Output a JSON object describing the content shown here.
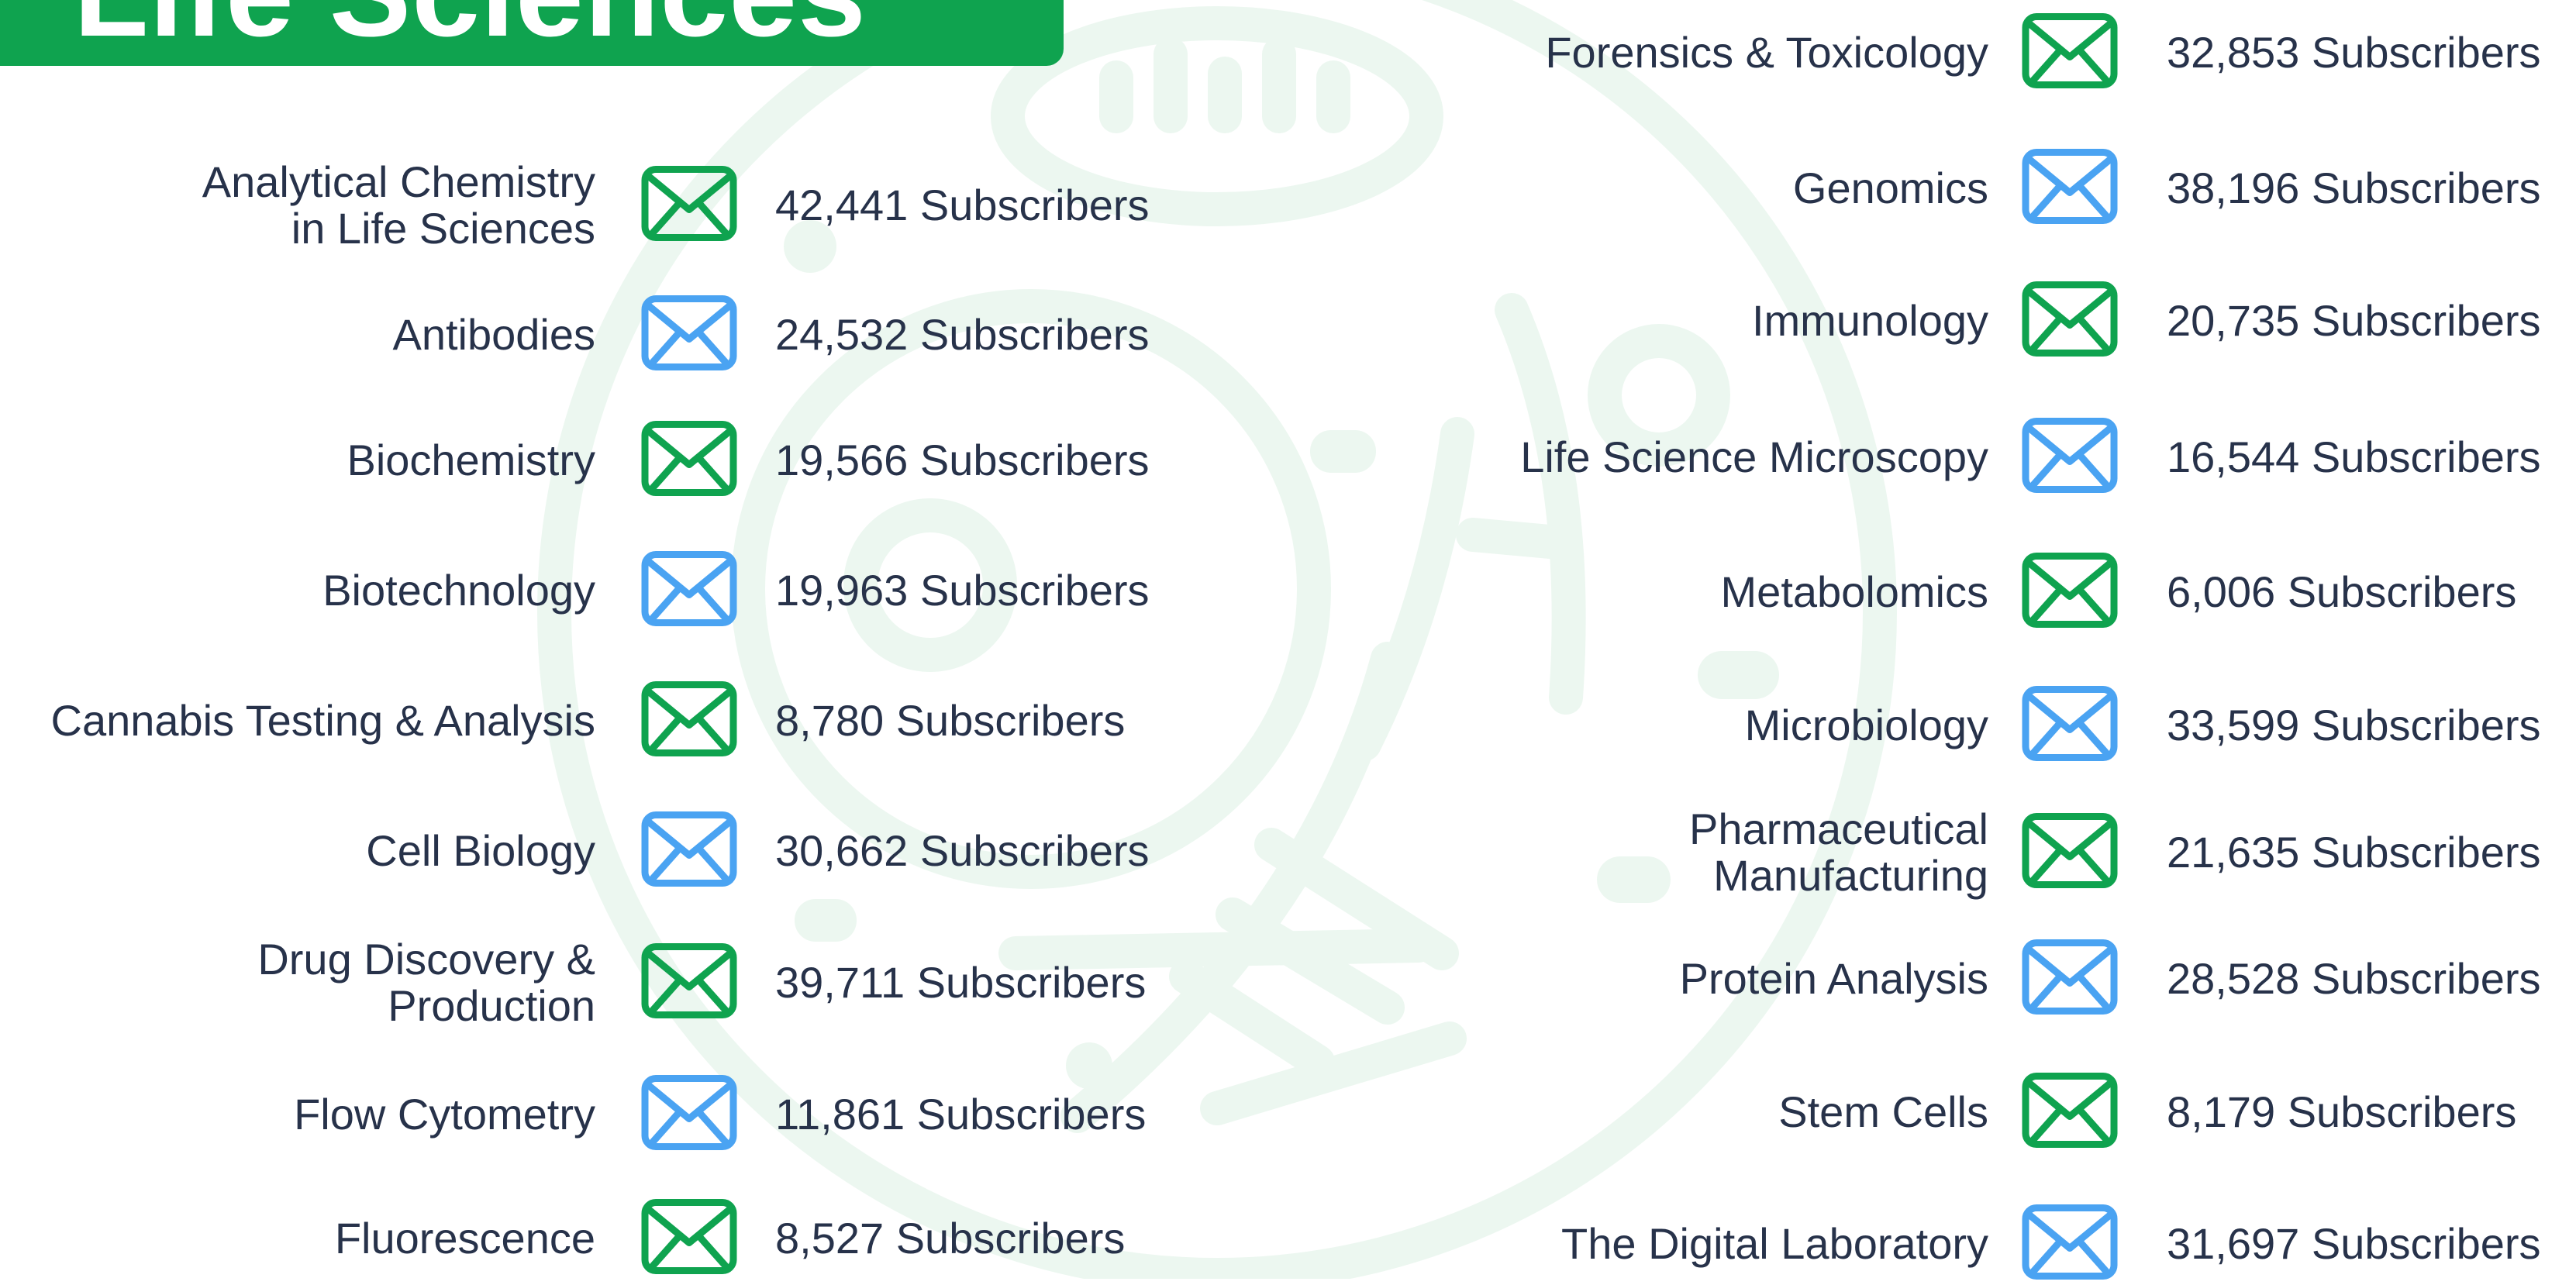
{
  "header": {
    "title": "Life Sciences"
  },
  "colors": {
    "green": "#0fa34f",
    "blue": "#4aa3f2",
    "text": "#27324a",
    "watermark": "#ecf7f0"
  },
  "left_column": [
    {
      "label_lines": [
        "Analytical Chemistry",
        "in Life Sciences"
      ],
      "count": "42,441 Subscribers",
      "icon": "envelope-icon",
      "color": "green"
    },
    {
      "label_lines": [
        "Antibodies"
      ],
      "count": "24,532 Subscribers",
      "icon": "envelope-icon",
      "color": "blue"
    },
    {
      "label_lines": [
        "Biochemistry"
      ],
      "count": "19,566 Subscribers",
      "icon": "envelope-icon",
      "color": "green"
    },
    {
      "label_lines": [
        "Biotechnology"
      ],
      "count": "19,963 Subscribers",
      "icon": "envelope-icon",
      "color": "blue"
    },
    {
      "label_lines": [
        "Cannabis Testing & Analysis"
      ],
      "count": "8,780 Subscribers",
      "icon": "envelope-icon",
      "color": "green"
    },
    {
      "label_lines": [
        "Cell Biology"
      ],
      "count": "30,662 Subscribers",
      "icon": "envelope-icon",
      "color": "blue"
    },
    {
      "label_lines": [
        "Drug Discovery &",
        "Production"
      ],
      "count": "39,711 Subscribers",
      "icon": "envelope-icon",
      "color": "green"
    },
    {
      "label_lines": [
        "Flow Cytometry"
      ],
      "count": "11,861 Subscribers",
      "icon": "envelope-icon",
      "color": "blue"
    },
    {
      "label_lines": [
        "Fluorescence"
      ],
      "count": "8,527 Subscribers",
      "icon": "envelope-icon",
      "color": "green"
    }
  ],
  "right_column": [
    {
      "label_lines": [
        "Forensics & Toxicology"
      ],
      "count": "32,853 Subscribers",
      "icon": "envelope-icon",
      "color": "green"
    },
    {
      "label_lines": [
        "Genomics"
      ],
      "count": "38,196 Subscribers",
      "icon": "envelope-icon",
      "color": "blue"
    },
    {
      "label_lines": [
        "Immunology"
      ],
      "count": "20,735 Subscribers",
      "icon": "envelope-icon",
      "color": "green"
    },
    {
      "label_lines": [
        "Life Science Microscopy"
      ],
      "count": "16,544 Subscribers",
      "icon": "envelope-icon",
      "color": "blue"
    },
    {
      "label_lines": [
        "Metabolomics"
      ],
      "count": "6,006 Subscribers",
      "icon": "envelope-icon",
      "color": "green"
    },
    {
      "label_lines": [
        "Microbiology"
      ],
      "count": "33,599 Subscribers",
      "icon": "envelope-icon",
      "color": "blue"
    },
    {
      "label_lines": [
        "Pharmaceutical",
        "Manufacturing"
      ],
      "count": "21,635 Subscribers",
      "icon": "envelope-icon",
      "color": "green"
    },
    {
      "label_lines": [
        "Protein Analysis"
      ],
      "count": "28,528 Subscribers",
      "icon": "envelope-icon",
      "color": "blue"
    },
    {
      "label_lines": [
        "Stem Cells"
      ],
      "count": "8,179 Subscribers",
      "icon": "envelope-icon",
      "color": "green"
    },
    {
      "label_lines": [
        "The Digital Laboratory"
      ],
      "count": "31,697 Subscribers",
      "icon": "envelope-icon",
      "color": "blue"
    }
  ]
}
